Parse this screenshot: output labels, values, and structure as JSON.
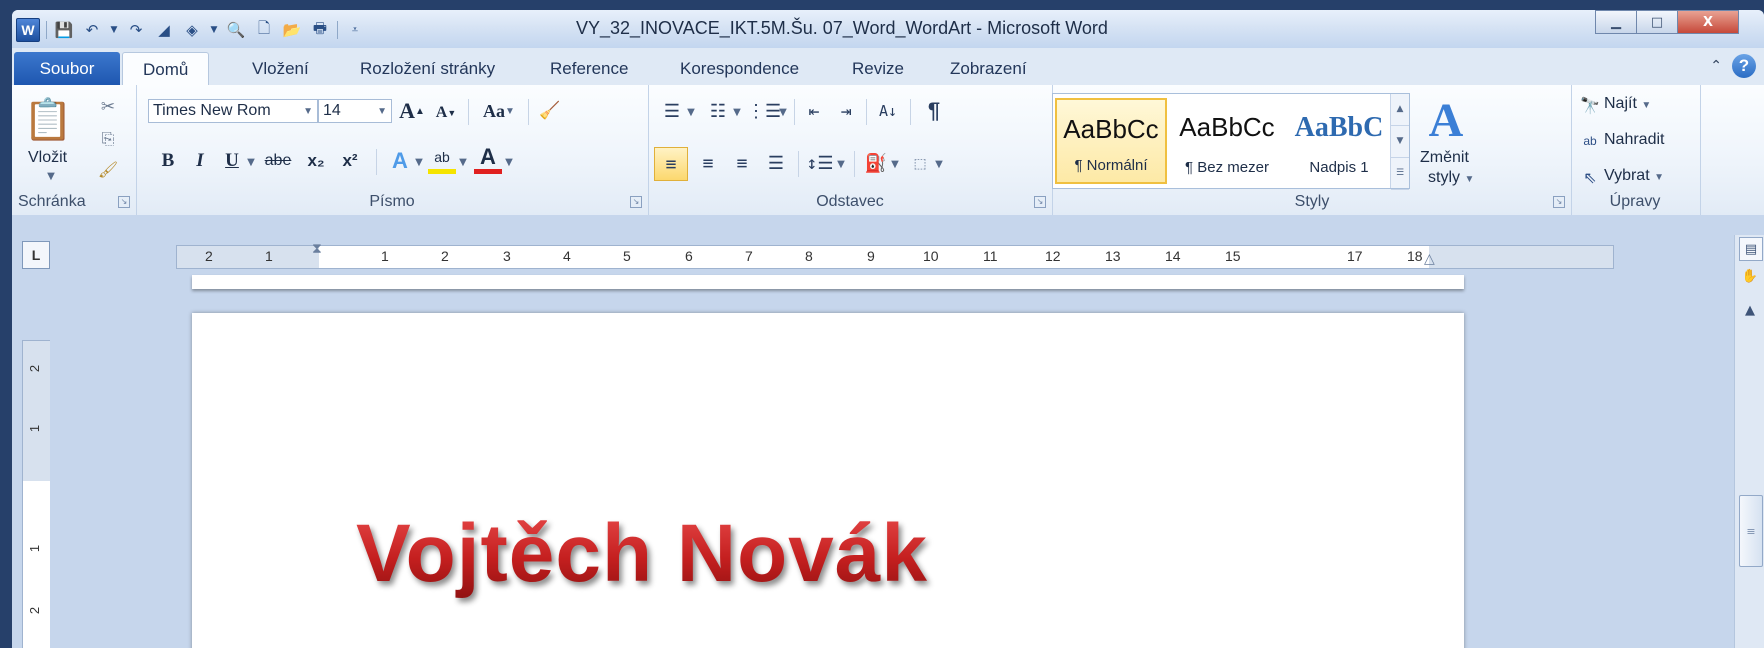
{
  "window": {
    "title": "VY_32_INOVACE_IKT.5M.Šu. 07_Word_WordArt - Microsoft Word",
    "controls": {
      "minimize": "▁",
      "maximize": "□",
      "close": "X"
    }
  },
  "qat": {
    "app_icon": "W",
    "items": [
      "save-icon",
      "undo-icon",
      "redo-icon",
      "format-icon",
      "shapes-icon",
      "print-preview-icon",
      "new-icon",
      "open-icon",
      "print-icon",
      "customize-icon"
    ]
  },
  "tabs": {
    "file": "Soubor",
    "items": [
      "Domů",
      "Vložení",
      "Rozložení stránky",
      "Reference",
      "Korespondence",
      "Revize",
      "Zobrazení"
    ],
    "active": "Domů"
  },
  "clipboard": {
    "paste": "Vložit",
    "label": "Schránka"
  },
  "font": {
    "name": "Times New Rom",
    "size": "14",
    "grow": "A",
    "shrink": "A",
    "case": "Aa",
    "bold": "B",
    "italic": "I",
    "underline": "U",
    "strike": "abe",
    "subscript": "x₂",
    "superscript": "x²",
    "effects": "A",
    "highlight": "ab",
    "color": "A",
    "label": "Písmo"
  },
  "paragraph": {
    "pilcrow": "¶",
    "label": "Odstavec"
  },
  "styles": {
    "items": [
      {
        "preview": "AaBbCc",
        "name": "¶ Normální",
        "selected": true
      },
      {
        "preview": "AaBbCc",
        "name": "¶ Bez mezer",
        "selected": false
      },
      {
        "preview": "AaBbC",
        "name": "Nadpis 1",
        "selected": false
      }
    ],
    "change_line1": "Změnit",
    "change_line2": "styly",
    "label": "Styly"
  },
  "editing": {
    "find": "Najít",
    "replace": "Nahradit",
    "select": "Vybrat",
    "label": "Úpravy"
  },
  "ruler": {
    "tab_selector": "L",
    "left_numbers": [
      "2",
      "1"
    ],
    "numbers": [
      "1",
      "2",
      "3",
      "4",
      "5",
      "6",
      "7",
      "8",
      "9",
      "10",
      "11",
      "12",
      "13",
      "14",
      "15",
      "",
      "17",
      "18"
    ],
    "vertical_numbers": [
      "2",
      "1",
      "",
      "1",
      "2"
    ]
  },
  "document": {
    "wordart_text": "Vojtěch Novák"
  },
  "colors": {
    "file_tab": "#2b68c2",
    "wordart": "#c41f1f",
    "style_selected": "#f0c040"
  }
}
